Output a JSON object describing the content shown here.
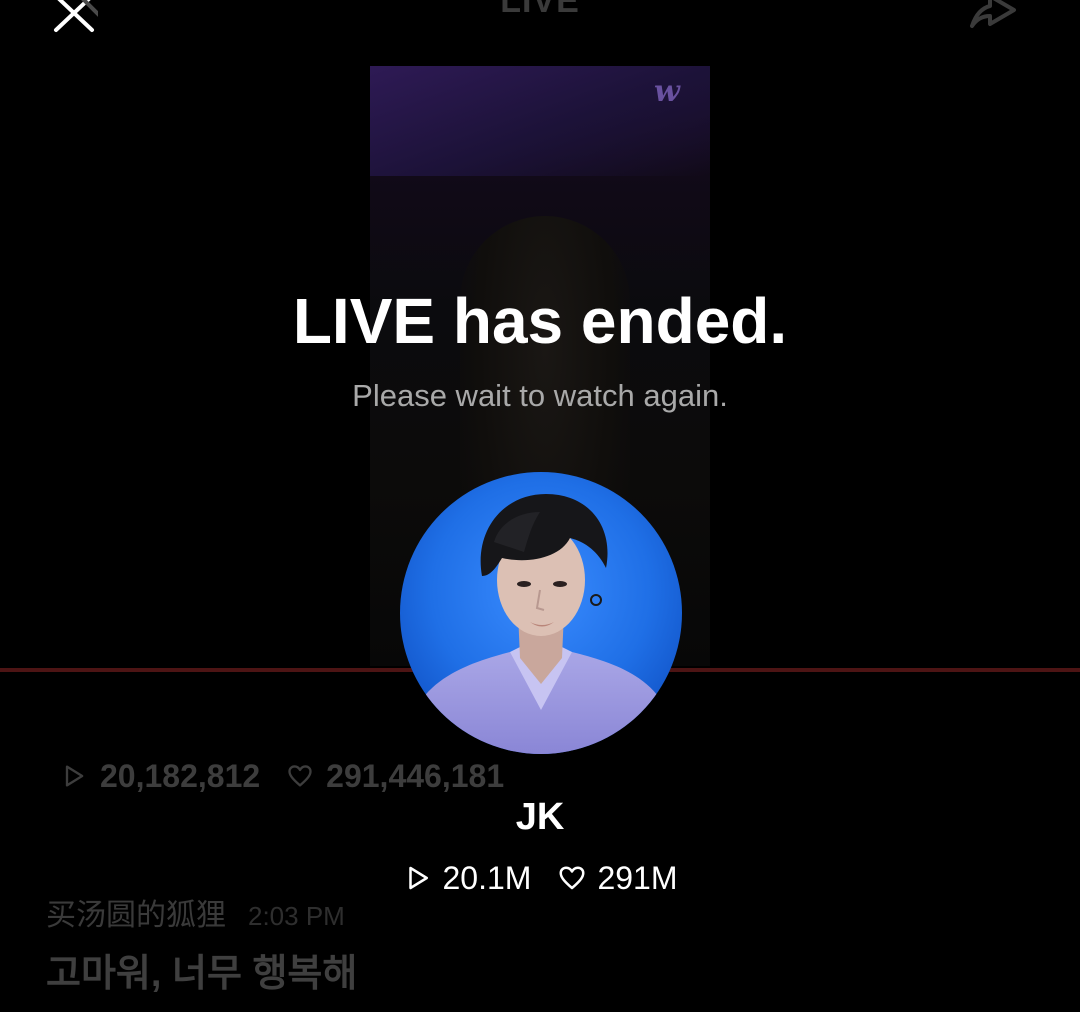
{
  "header": {
    "title": "LIVE",
    "close_icon": "close-icon",
    "share_icon": "share-icon"
  },
  "background": {
    "logo_text": "w",
    "stats": {
      "plays": "20,182,812",
      "likes": "291,446,181"
    },
    "chat": {
      "username": "买汤圆的狐狸",
      "time": "2:03 PM",
      "message": "고마워, 너무 행복해"
    }
  },
  "overlay": {
    "headline": "LIVE has ended.",
    "subline": "Please wait to watch again.",
    "artist_name": "JK",
    "plays": "20.1M",
    "likes": "291M"
  },
  "colors": {
    "background": "#000000",
    "progress_line": "#4d1414",
    "avatar_backdrop": "#1f6fe6"
  }
}
